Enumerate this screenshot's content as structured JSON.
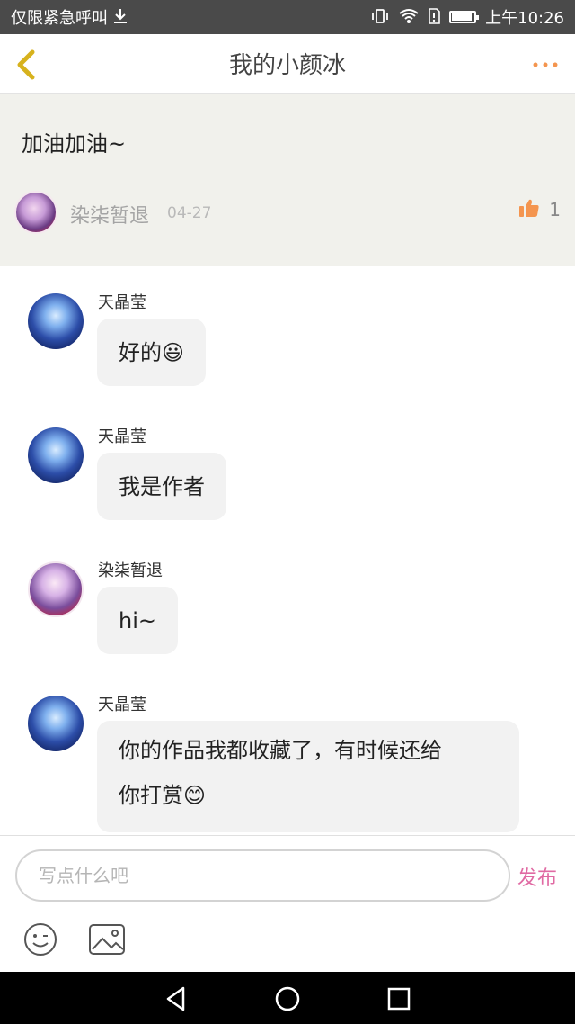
{
  "status_bar": {
    "left_text": "仅限紧急呼叫",
    "time": "上午10:26"
  },
  "header": {
    "title": "我的小颜冰"
  },
  "post": {
    "text": "加油加油~",
    "author": "染柒暂退",
    "date": "04-27",
    "likes": "1"
  },
  "messages": [
    {
      "name": "天晶莹",
      "text": "好的😃"
    },
    {
      "name": "天晶莹",
      "text": "我是作者"
    },
    {
      "name": "染柒暂退",
      "text": "hi~"
    },
    {
      "name": "天晶莹",
      "line1": "你的作品我都收藏了，有时候还给",
      "line2": "你打赏😊"
    }
  ],
  "composer": {
    "placeholder": "写点什么吧",
    "send_label": "发布"
  },
  "colors": {
    "accent_orange": "#f4954f",
    "send_pink": "#e06aa3",
    "post_bg": "#f1f1ec",
    "bubble_bg": "#f2f2f2"
  }
}
